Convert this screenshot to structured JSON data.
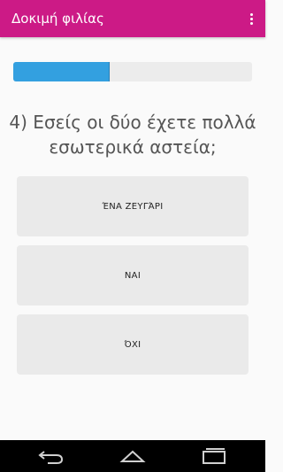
{
  "app": {
    "title": "Δοκιμή φιλίας",
    "primary_color": "#cc1a86",
    "menu_icon": "overflow-menu-icon"
  },
  "quiz": {
    "progress_fraction": 0.4,
    "question": "4) Εσείς οι δύο έχετε πολλά εσωτερικά αστεία;",
    "answers": [
      "ΈΝΑ ΖΕΥΓΆΡΙ",
      "ΝΑΙ",
      "ΌΧΙ"
    ]
  },
  "navigation": {
    "back_icon": "back-icon",
    "home_icon": "home-icon",
    "recents_icon": "recents-icon"
  }
}
